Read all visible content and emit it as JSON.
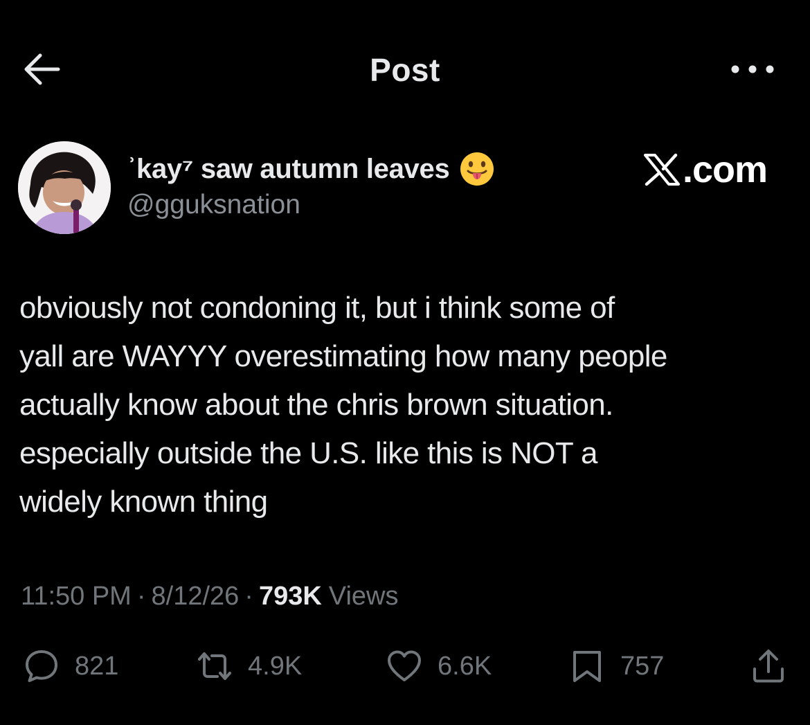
{
  "header": {
    "title": "Post",
    "back_icon": "arrow-left-icon",
    "more_icon": "more-horizontal-icon"
  },
  "author": {
    "display_name": "ʾkay⁷ saw autumn leaves",
    "emoji": "face-with-tongue-icon",
    "handle": "@gguksnation",
    "avatar": "avatar"
  },
  "watermark": {
    "logo_icon": "x-logo-icon",
    "text": ".com"
  },
  "tweet": {
    "lines": [
      "obviously not condoning it, but i think some of",
      "yall are WAYYY overestimating how many people",
      "actually know about the chris brown situation.",
      "especially outside the U.S. like this is NOT a",
      "widely known thing"
    ]
  },
  "meta": {
    "time": "11:50 PM",
    "date": "8/12/26",
    "separator": "·",
    "views_count": "793K",
    "views_label": "Views"
  },
  "actions": {
    "replies": "821",
    "reposts": "4.9K",
    "likes": "6.6K",
    "bookmarks": "757"
  },
  "colors": {
    "background": "#000000",
    "primary_text": "#e7e9ea",
    "secondary_text": "#71767b"
  }
}
